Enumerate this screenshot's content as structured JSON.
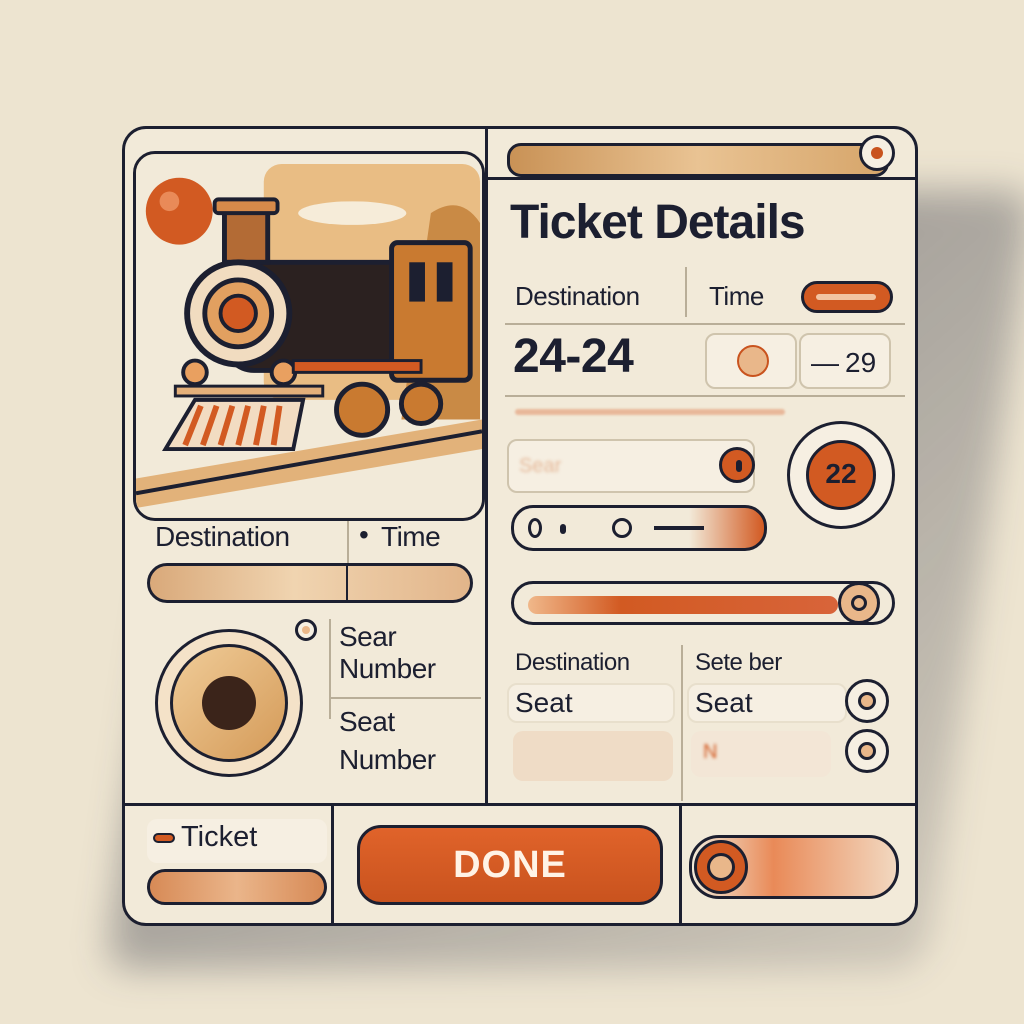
{
  "colors": {
    "accent": "#d25a22",
    "ink": "#1c1f30",
    "panel": "#f2ead9",
    "tan": "#e2b58a"
  },
  "panel_title": "Ticket Details",
  "top_fields": {
    "destination_label": "Destination",
    "time_label": "Time",
    "time_value": "24-24",
    "time_b": "29",
    "time_prefix": "—"
  },
  "left_fields": {
    "destination_label": "Destination",
    "time_label": "Time",
    "bullet": "•"
  },
  "seat_block": {
    "label_1": "Sear Number",
    "label_2": "Seat Number"
  },
  "right_seat": {
    "seat_number": "22",
    "field_hint": "Sear"
  },
  "bottom_grid": {
    "col1_header": "Destination",
    "col2_header": "Sete ber",
    "col1_seat": "Seat",
    "col2_seat": "Seat",
    "field_value": "N"
  },
  "footer": {
    "ticket_label": "Ticket",
    "done_label": "DONE"
  },
  "icons": {
    "train": "steam-train-icon",
    "sun": "sun-icon"
  }
}
